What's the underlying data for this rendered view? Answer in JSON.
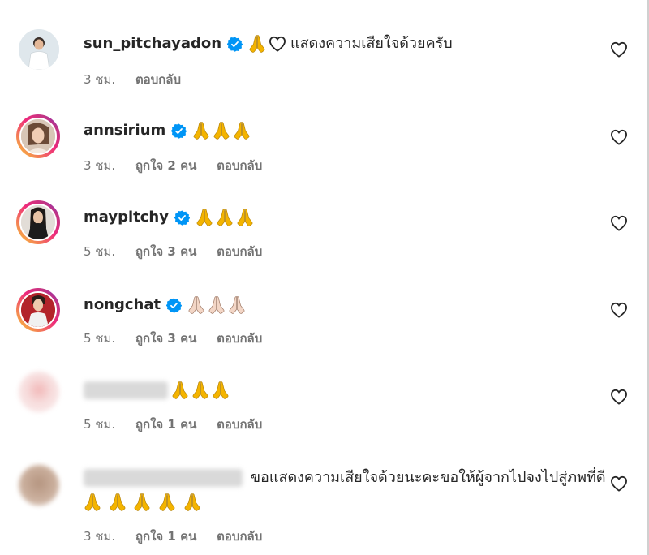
{
  "comments": [
    {
      "user": "sun_pitchayadon",
      "text": "แสดงความเสียใจด้วยครับ",
      "time": "3 ชม.",
      "likes": "",
      "reply": "ตอบกลับ"
    },
    {
      "user": "annsirium",
      "text": "",
      "time": "3 ชม.",
      "likes": "ถูกใจ 2 คน",
      "reply": "ตอบกลับ"
    },
    {
      "user": "maypitchy",
      "text": "",
      "time": "5 ชม.",
      "likes": "ถูกใจ 3 คน",
      "reply": "ตอบกลับ"
    },
    {
      "user": "nongchat",
      "text": "",
      "time": "5 ชม.",
      "likes": "ถูกใจ 3 คน",
      "reply": "ตอบกลับ"
    },
    {
      "user": "",
      "text": "",
      "time": "5 ชม.",
      "likes": "ถูกใจ 1 คน",
      "reply": "ตอบกลับ"
    },
    {
      "user": "",
      "text": "ขอแสดงความเสียใจด้วยนะคะขอให้ผู้จากไปจงไปสู่ภพที่ดี",
      "time": "3 ชม.",
      "likes": "ถูกใจ 1 คน",
      "reply": "ตอบกลับ"
    }
  ],
  "icons": {
    "verified": "verified-badge-icon",
    "pray": "folded-hands-emoji",
    "heart": "heart-outline-icon"
  },
  "colors": {
    "verified": "#0095f6",
    "meta": "#737373",
    "text": "#262626"
  }
}
